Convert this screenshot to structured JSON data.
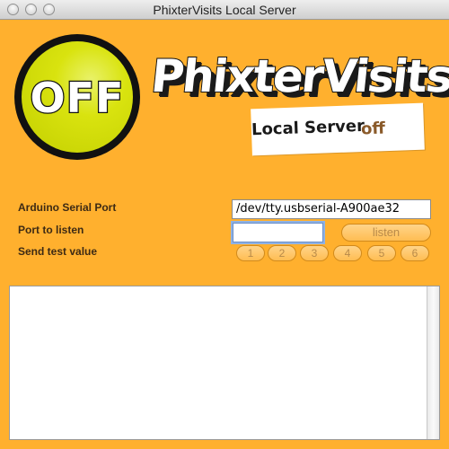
{
  "window": {
    "title": "PhixterVisits Local Server"
  },
  "status": {
    "badge_text": "OFF",
    "indicator_color": "#d9e30f"
  },
  "branding": {
    "logo_text": "PhixterVisits",
    "subtitle_label": "Local Server",
    "subtitle_status": "off"
  },
  "form": {
    "serial_port_label": "Arduino Serial Port",
    "serial_port_value": "/dev/tty.usbserial-A900ae32",
    "listen_port_label": "Port to listen",
    "listen_port_value": "",
    "listen_button": "listen",
    "test_label": "Send test value",
    "test_buttons": [
      "1",
      "2",
      "3",
      "4",
      "5",
      "6"
    ]
  },
  "log": {
    "content": ""
  },
  "colors": {
    "background": "#ffb02e",
    "button_face": "#ffc664",
    "button_text": "#b88a4a"
  }
}
